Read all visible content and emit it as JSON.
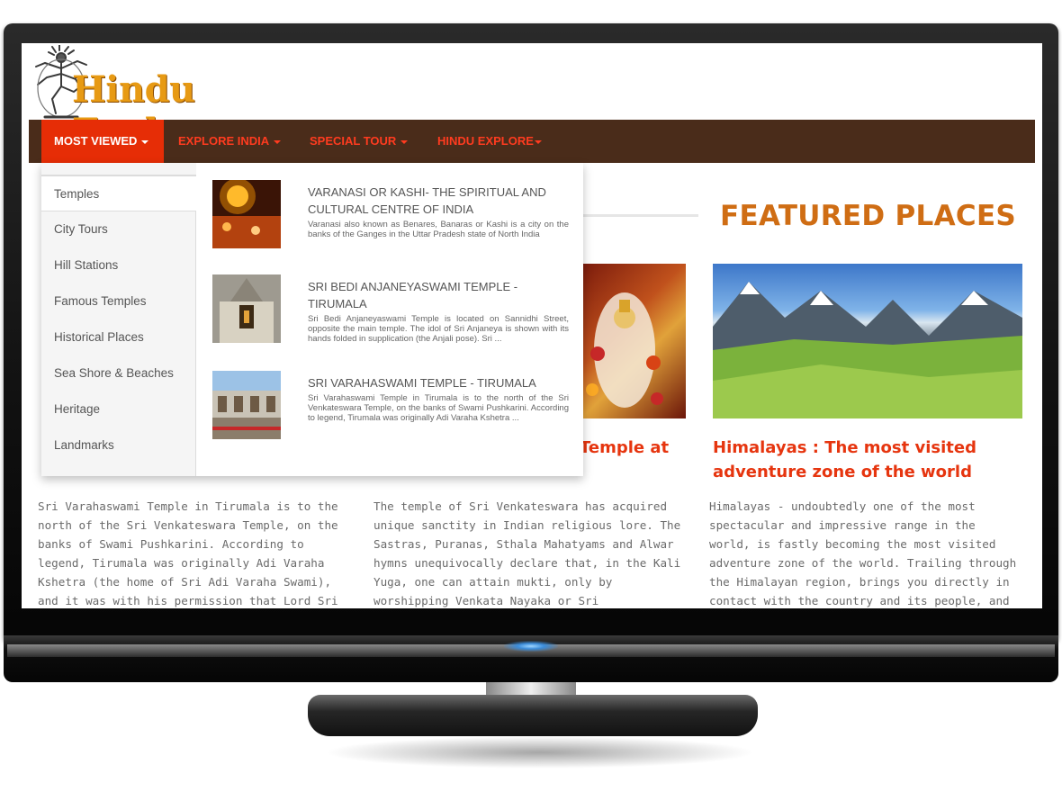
{
  "brand": {
    "name": "Hindu Explore"
  },
  "nav": {
    "items": [
      {
        "label": "MOST VIEWED"
      },
      {
        "label": "EXPLORE INDIA"
      },
      {
        "label": "SPECIAL TOUR"
      },
      {
        "label": "HINDU EXPLORE"
      }
    ]
  },
  "dropdown": {
    "menu": [
      {
        "label": "Temples"
      },
      {
        "label": "City Tours"
      },
      {
        "label": "Hill Stations"
      },
      {
        "label": "Famous Temples"
      },
      {
        "label": "Historical Places"
      },
      {
        "label": "Sea Shore & Beaches"
      },
      {
        "label": "Heritage"
      },
      {
        "label": "Landmarks"
      }
    ],
    "entries": [
      {
        "title": "VARANASI OR KASHI- THE SPIRITUAL AND CULTURAL CENTRE OF INDIA",
        "desc": "Varanasi also known as Benares, Banaras or Kashi is a city on the banks of the Ganges in the Uttar Pradesh state of North India"
      },
      {
        "title": "SRI BEDI ANJANEYASWAMI TEMPLE - TIRUMALA",
        "desc": "Sri Bedi Anjaneyaswami Temple is located on Sannidhi Street, opposite the main temple. The idol of Sri Anjaneya is shown with its hands folded in supplication (the Anjali pose). Sri ..."
      },
      {
        "title": "SRI VARAHASWAMI TEMPLE - TIRUMALA",
        "desc": "Sri Varahaswami Temple in Tirumala is to the north of the Sri Venkateswara Temple, on the banks of Swami Pushkarini. According to legend, Tirumala was originally Adi Varaha Kshetra ..."
      }
    ]
  },
  "featured": {
    "heading": "FEATURED PLACES",
    "cards": [
      {
        "title_visible": "",
        "body": "Sri Varahaswami Temple in Tirumala is to the north of the Sri Venkateswara Temple, on the banks of Swami Pushkarini. According to legend, Tirumala was originally Adi Varaha Kshetra (the home of Sri Adi Varaha Swami), and it was with his permission that Lord Sri Venkateswara took up residence here."
      },
      {
        "title_visible": "Temple at",
        "body": "The temple of Sri Venkateswara has acquired unique sanctity in Indian religious lore. The Sastras, Puranas, Sthala Mahatyams and Alwar hymns unequivocally declare that, in the Kali Yuga, one can attain mukti, only by worshipping Venkata Nayaka or Sri Venkateswara"
      },
      {
        "title_line1": "Himalayas : The most visited",
        "title_line2": "adventure zone of the world",
        "body": "Himalayas - undoubtedly one of the most spectacular and impressive range in the world, is fastly becoming the most visited adventure zone of the world. Trailing through the Himalayan region, brings you directly in contact with the country and its people, and helps to foster an appreciation of"
      }
    ]
  },
  "colors": {
    "nav_bg": "#4a2c1a",
    "nav_active": "#e62d06",
    "nav_text": "#ff3b1f",
    "brand_orange": "#e79a14",
    "heading_orange": "#cf6d14",
    "card_title_red": "#e6350f"
  }
}
